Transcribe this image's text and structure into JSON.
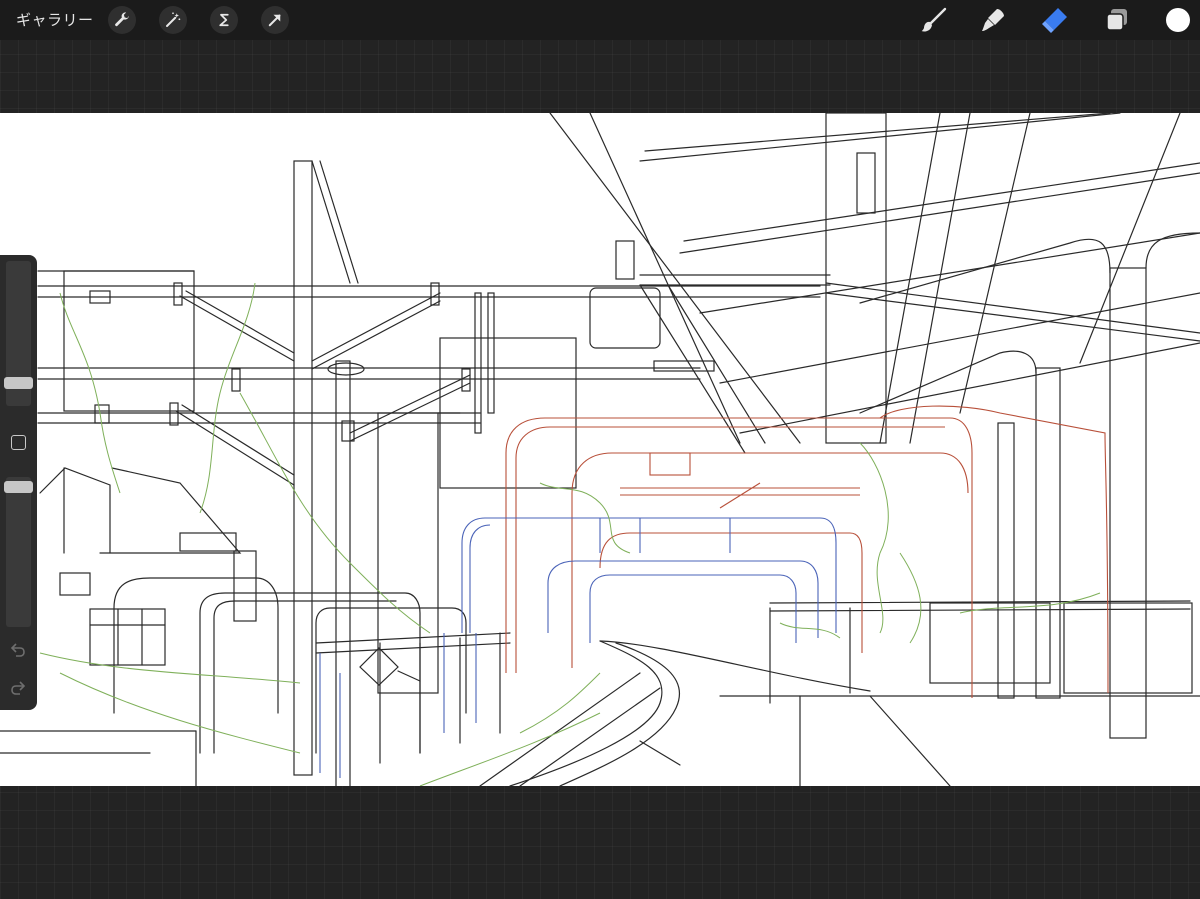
{
  "topbar": {
    "gallery_label": "ギャラリー",
    "left_tools": [
      "wrench-icon",
      "magic-wand-icon",
      "selection-s-icon",
      "transform-arrow-icon"
    ],
    "right_tools": [
      "brush-icon",
      "smudge-icon",
      "eraser-icon",
      "layers-icon"
    ],
    "active_tool": "eraser-icon",
    "active_color": "#ffffff",
    "accent": "#3a7cf0"
  },
  "sidebar": {
    "size_slider": "brush-size-slider",
    "opacity_slider": "brush-opacity-slider",
    "buttons": [
      "modify-button",
      "undo-button",
      "redo-button"
    ]
  },
  "canvas": {
    "content": "line-art-drawing"
  },
  "colors": {
    "line_black": "#2a2a2a",
    "line_red": "#b8503a",
    "line_blue": "#4a63b8",
    "line_green": "#7fb05a"
  }
}
